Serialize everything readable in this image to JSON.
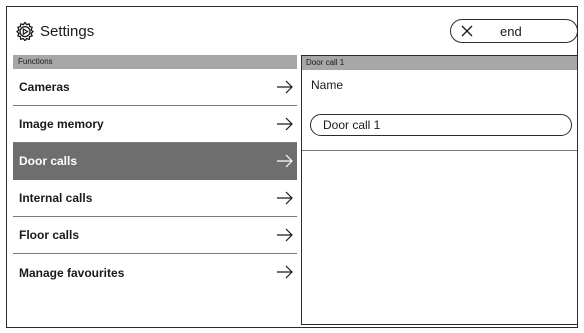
{
  "header": {
    "title": "Settings",
    "end_label": "end",
    "icon": "gear-icon",
    "close_icon": "close-icon"
  },
  "functions": {
    "heading": "Functions",
    "items": [
      {
        "label": "Cameras",
        "selected": false
      },
      {
        "label": "Image memory",
        "selected": false
      },
      {
        "label": "Door calls",
        "selected": true
      },
      {
        "label": "Internal calls",
        "selected": false
      },
      {
        "label": "Floor calls",
        "selected": false
      },
      {
        "label": "Manage favourites",
        "selected": false
      }
    ]
  },
  "detail": {
    "heading": "Door call 1",
    "name_label": "Name",
    "name_value": "Door call 1"
  },
  "colors": {
    "header_bar": "#a7a7a7",
    "selected_item": "#6e6e6e",
    "selected_text": "#ffffff"
  }
}
